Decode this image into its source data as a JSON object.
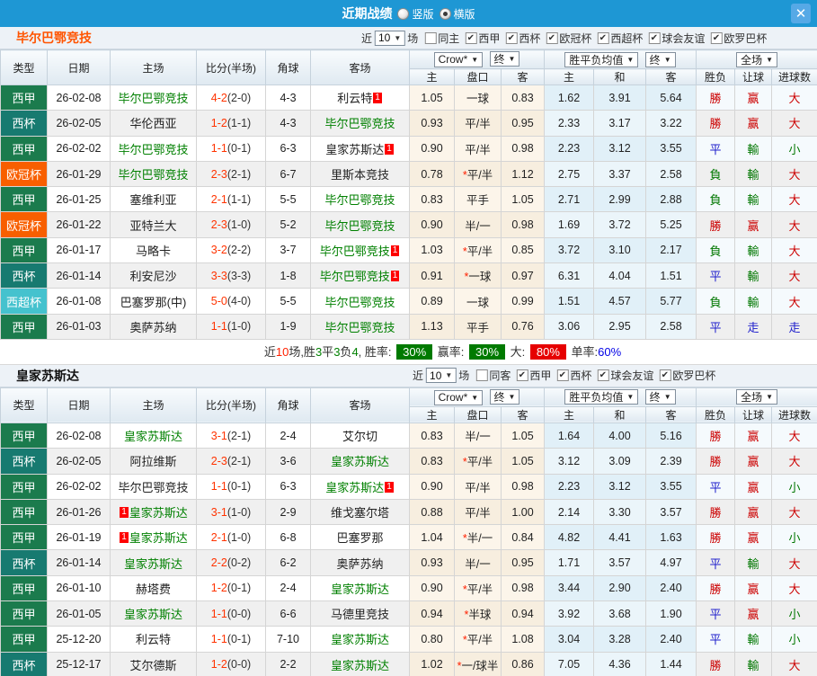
{
  "topbar": {
    "title": "近期战绩",
    "vertical_label": "竖版",
    "horizontal_label": "横版"
  },
  "icons": {
    "close": "✕",
    "dropdown_arrow": "▼",
    "check": "✔"
  },
  "labels": {
    "near": "近",
    "games": "场"
  },
  "table_head": {
    "columns": [
      "类型",
      "日期",
      "主场",
      "比分(半场)",
      "角球",
      "客场"
    ],
    "subcols": [
      "主",
      "盘口",
      "客",
      "主",
      "和",
      "客",
      "胜负",
      "让球",
      "进球数"
    ],
    "selects": {
      "crow": "Crow*",
      "final": "终",
      "avg": "胜平负均值",
      "full": "全场"
    }
  },
  "league_colors": {
    "西甲": "#1B7B4D",
    "西杯": "#177A70",
    "欧冠杯": "#F85F00",
    "西超杯": "#45C2CE"
  },
  "value_colors": {
    "win_red": "#CC0000",
    "draw_blue": "#2020CC",
    "lose_green": "#007700"
  },
  "sections": [
    {
      "team": "毕尔巴鄂竞技",
      "team_color": "#FF5400",
      "filter": {
        "count": "10",
        "same": {
          "label": "同主",
          "checked": false
        },
        "leagues": [
          {
            "label": "西甲",
            "checked": true
          },
          {
            "label": "西杯",
            "checked": true
          },
          {
            "label": "欧冠杯",
            "checked": true
          },
          {
            "label": "西超杯",
            "checked": true
          },
          {
            "label": "球会友谊",
            "checked": true
          },
          {
            "label": "欧罗巴杯",
            "checked": true
          }
        ]
      },
      "rows": [
        {
          "league": "西甲",
          "date": "26-02-08",
          "home": {
            "name": "毕尔巴鄂竞技",
            "focus": true
          },
          "score": "4-2",
          "half": "(2-0)",
          "corner": "4-3",
          "away": {
            "name": "利云特",
            "badge": "1",
            "badge_pos": "after"
          },
          "odds": [
            "1.05",
            "一球",
            "0.83"
          ],
          "avg": [
            "1.62",
            "3.91",
            "5.64"
          ],
          "result": [
            "勝",
            "赢",
            "大"
          ]
        },
        {
          "league": "西杯",
          "date": "26-02-05",
          "home": {
            "name": "华伦西亚"
          },
          "score": "1-2",
          "half": "(1-1)",
          "corner": "4-3",
          "away": {
            "name": "毕尔巴鄂竞技",
            "focus": true
          },
          "odds": [
            "0.93",
            "平/半",
            "0.95"
          ],
          "avg": [
            "2.33",
            "3.17",
            "3.22"
          ],
          "result": [
            "勝",
            "赢",
            "大"
          ]
        },
        {
          "league": "西甲",
          "date": "26-02-02",
          "home": {
            "name": "毕尔巴鄂竞技",
            "focus": true
          },
          "score": "1-1",
          "half": "(0-1)",
          "corner": "6-3",
          "away": {
            "name": "皇家苏斯达",
            "badge": "1",
            "badge_pos": "after"
          },
          "odds": [
            "0.90",
            "平/半",
            "0.98"
          ],
          "avg": [
            "2.23",
            "3.12",
            "3.55"
          ],
          "result": [
            "平",
            "輸",
            "小"
          ]
        },
        {
          "league": "欧冠杯",
          "date": "26-01-29",
          "home": {
            "name": "毕尔巴鄂竞技",
            "focus": true
          },
          "score": "2-3",
          "half": "(2-1)",
          "corner": "6-7",
          "away": {
            "name": "里斯本竞技"
          },
          "odds": [
            "0.78",
            "*平/半",
            "1.12"
          ],
          "avg": [
            "2.75",
            "3.37",
            "2.58"
          ],
          "result": [
            "負",
            "輸",
            "大"
          ]
        },
        {
          "league": "西甲",
          "date": "26-01-25",
          "home": {
            "name": "塞维利亚"
          },
          "score": "2-1",
          "half": "(1-1)",
          "corner": "5-5",
          "away": {
            "name": "毕尔巴鄂竞技",
            "focus": true
          },
          "odds": [
            "0.83",
            "平手",
            "1.05"
          ],
          "avg": [
            "2.71",
            "2.99",
            "2.88"
          ],
          "result": [
            "負",
            "輸",
            "大"
          ]
        },
        {
          "league": "欧冠杯",
          "date": "26-01-22",
          "home": {
            "name": "亚特兰大"
          },
          "score": "2-3",
          "half": "(1-0)",
          "corner": "5-2",
          "away": {
            "name": "毕尔巴鄂竞技",
            "focus": true
          },
          "odds": [
            "0.90",
            "半/一",
            "0.98"
          ],
          "avg": [
            "1.69",
            "3.72",
            "5.25"
          ],
          "result": [
            "勝",
            "赢",
            "大"
          ]
        },
        {
          "league": "西甲",
          "date": "26-01-17",
          "home": {
            "name": "马略卡"
          },
          "score": "3-2",
          "half": "(2-2)",
          "corner": "3-7",
          "away": {
            "name": "毕尔巴鄂竞技",
            "focus": true,
            "badge": "1",
            "badge_pos": "after"
          },
          "odds": [
            "1.03",
            "*平/半",
            "0.85"
          ],
          "avg": [
            "3.72",
            "3.10",
            "2.17"
          ],
          "result": [
            "負",
            "輸",
            "大"
          ]
        },
        {
          "league": "西杯",
          "date": "26-01-14",
          "home": {
            "name": "利安尼沙"
          },
          "score": "3-3",
          "half": "(3-3)",
          "corner": "1-8",
          "away": {
            "name": "毕尔巴鄂竞技",
            "focus": true,
            "badge": "1",
            "badge_pos": "after"
          },
          "odds": [
            "0.91",
            "*一球",
            "0.97"
          ],
          "avg": [
            "6.31",
            "4.04",
            "1.51"
          ],
          "result": [
            "平",
            "輸",
            "大"
          ]
        },
        {
          "league": "西超杯",
          "date": "26-01-08",
          "home": {
            "name": "巴塞罗那(中)"
          },
          "score": "5-0",
          "half": "(4-0)",
          "corner": "5-5",
          "away": {
            "name": "毕尔巴鄂竞技",
            "focus": true
          },
          "odds": [
            "0.89",
            "一球",
            "0.99"
          ],
          "avg": [
            "1.51",
            "4.57",
            "5.77"
          ],
          "result": [
            "負",
            "輸",
            "大"
          ]
        },
        {
          "league": "西甲",
          "date": "26-01-03",
          "home": {
            "name": "奥萨苏纳"
          },
          "score": "1-1",
          "half": "(1-0)",
          "corner": "1-9",
          "away": {
            "name": "毕尔巴鄂竞技",
            "focus": true
          },
          "odds": [
            "1.13",
            "平手",
            "0.76"
          ],
          "avg": [
            "3.06",
            "2.95",
            "2.58"
          ],
          "result": [
            "平",
            "走",
            "走"
          ]
        }
      ],
      "summary": [
        {
          "t": "近",
          "c": "k"
        },
        {
          "t": "10",
          "c": "r"
        },
        {
          "t": "场,胜",
          "c": "k"
        },
        {
          "t": "3",
          "c": "g"
        },
        {
          "t": "平",
          "c": "k"
        },
        {
          "t": "3",
          "c": "g"
        },
        {
          "t": "负",
          "c": "k"
        },
        {
          "t": "4",
          "c": "g"
        },
        {
          "t": ", 胜率: ",
          "c": "k"
        },
        {
          "t": "30%",
          "c": "bg"
        },
        {
          "t": " 赢率: ",
          "c": "k"
        },
        {
          "t": "30%",
          "c": "bg"
        },
        {
          "t": " 大: ",
          "c": "k"
        },
        {
          "t": "80%",
          "c": "br"
        },
        {
          "t": " 单率:",
          "c": "k"
        },
        {
          "t": "60%",
          "c": "bl"
        }
      ]
    },
    {
      "team": "皇家苏斯达",
      "team_color": "#111111",
      "filter": {
        "count": "10",
        "same": {
          "label": "同客",
          "checked": false
        },
        "leagues": [
          {
            "label": "西甲",
            "checked": true
          },
          {
            "label": "西杯",
            "checked": true
          },
          {
            "label": "球会友谊",
            "checked": true
          },
          {
            "label": "欧罗巴杯",
            "checked": true
          }
        ]
      },
      "rows": [
        {
          "league": "西甲",
          "date": "26-02-08",
          "home": {
            "name": "皇家苏斯达",
            "focus": true
          },
          "score": "3-1",
          "half": "(2-1)",
          "corner": "2-4",
          "away": {
            "name": "艾尔切"
          },
          "odds": [
            "0.83",
            "半/一",
            "1.05"
          ],
          "avg": [
            "1.64",
            "4.00",
            "5.16"
          ],
          "result": [
            "勝",
            "赢",
            "大"
          ]
        },
        {
          "league": "西杯",
          "date": "26-02-05",
          "home": {
            "name": "阿拉维斯"
          },
          "score": "2-3",
          "half": "(2-1)",
          "corner": "3-6",
          "away": {
            "name": "皇家苏斯达",
            "focus": true
          },
          "odds": [
            "0.83",
            "*平/半",
            "1.05"
          ],
          "avg": [
            "3.12",
            "3.09",
            "2.39"
          ],
          "result": [
            "勝",
            "赢",
            "大"
          ]
        },
        {
          "league": "西甲",
          "date": "26-02-02",
          "home": {
            "name": "毕尔巴鄂竞技"
          },
          "score": "1-1",
          "half": "(0-1)",
          "corner": "6-3",
          "away": {
            "name": "皇家苏斯达",
            "focus": true,
            "badge": "1",
            "badge_pos": "after"
          },
          "odds": [
            "0.90",
            "平/半",
            "0.98"
          ],
          "avg": [
            "2.23",
            "3.12",
            "3.55"
          ],
          "result": [
            "平",
            "赢",
            "小"
          ]
        },
        {
          "league": "西甲",
          "date": "26-01-26",
          "home": {
            "name": "皇家苏斯达",
            "focus": true,
            "badge": "1",
            "badge_pos": "before"
          },
          "score": "3-1",
          "half": "(1-0)",
          "corner": "2-9",
          "away": {
            "name": "维戈塞尔塔"
          },
          "odds": [
            "0.88",
            "平/半",
            "1.00"
          ],
          "avg": [
            "2.14",
            "3.30",
            "3.57"
          ],
          "result": [
            "勝",
            "赢",
            "大"
          ]
        },
        {
          "league": "西甲",
          "date": "26-01-19",
          "home": {
            "name": "皇家苏斯达",
            "focus": true,
            "badge": "1",
            "badge_pos": "before"
          },
          "score": "2-1",
          "half": "(1-0)",
          "corner": "6-8",
          "away": {
            "name": "巴塞罗那"
          },
          "odds": [
            "1.04",
            "*半/一",
            "0.84"
          ],
          "avg": [
            "4.82",
            "4.41",
            "1.63"
          ],
          "result": [
            "勝",
            "赢",
            "小"
          ]
        },
        {
          "league": "西杯",
          "date": "26-01-14",
          "home": {
            "name": "皇家苏斯达",
            "focus": true
          },
          "score": "2-2",
          "half": "(0-2)",
          "corner": "6-2",
          "away": {
            "name": "奥萨苏纳"
          },
          "odds": [
            "0.93",
            "半/一",
            "0.95"
          ],
          "avg": [
            "1.71",
            "3.57",
            "4.97"
          ],
          "result": [
            "平",
            "輸",
            "大"
          ]
        },
        {
          "league": "西甲",
          "date": "26-01-10",
          "home": {
            "name": "赫塔费"
          },
          "score": "1-2",
          "half": "(0-1)",
          "corner": "2-4",
          "away": {
            "name": "皇家苏斯达",
            "focus": true
          },
          "odds": [
            "0.90",
            "*平/半",
            "0.98"
          ],
          "avg": [
            "3.44",
            "2.90",
            "2.40"
          ],
          "result": [
            "勝",
            "赢",
            "大"
          ]
        },
        {
          "league": "西甲",
          "date": "26-01-05",
          "home": {
            "name": "皇家苏斯达",
            "focus": true
          },
          "score": "1-1",
          "half": "(0-0)",
          "corner": "6-6",
          "away": {
            "name": "马德里竞技"
          },
          "odds": [
            "0.94",
            "*半球",
            "0.94"
          ],
          "avg": [
            "3.92",
            "3.68",
            "1.90"
          ],
          "result": [
            "平",
            "赢",
            "小"
          ]
        },
        {
          "league": "西甲",
          "date": "25-12-20",
          "home": {
            "name": "利云特"
          },
          "score": "1-1",
          "half": "(0-1)",
          "corner": "7-10",
          "away": {
            "name": "皇家苏斯达",
            "focus": true
          },
          "odds": [
            "0.80",
            "*平/半",
            "1.08"
          ],
          "avg": [
            "3.04",
            "3.28",
            "2.40"
          ],
          "result": [
            "平",
            "輸",
            "小"
          ]
        },
        {
          "league": "西杯",
          "date": "25-12-17",
          "home": {
            "name": "艾尔德斯"
          },
          "score": "1-2",
          "half": "(0-0)",
          "corner": "2-2",
          "away": {
            "name": "皇家苏斯达",
            "focus": true
          },
          "odds": [
            "1.02",
            "*一/球半",
            "0.86"
          ],
          "avg": [
            "7.05",
            "4.36",
            "1.44"
          ],
          "result": [
            "勝",
            "輸",
            "大"
          ]
        }
      ],
      "summary": null
    }
  ]
}
